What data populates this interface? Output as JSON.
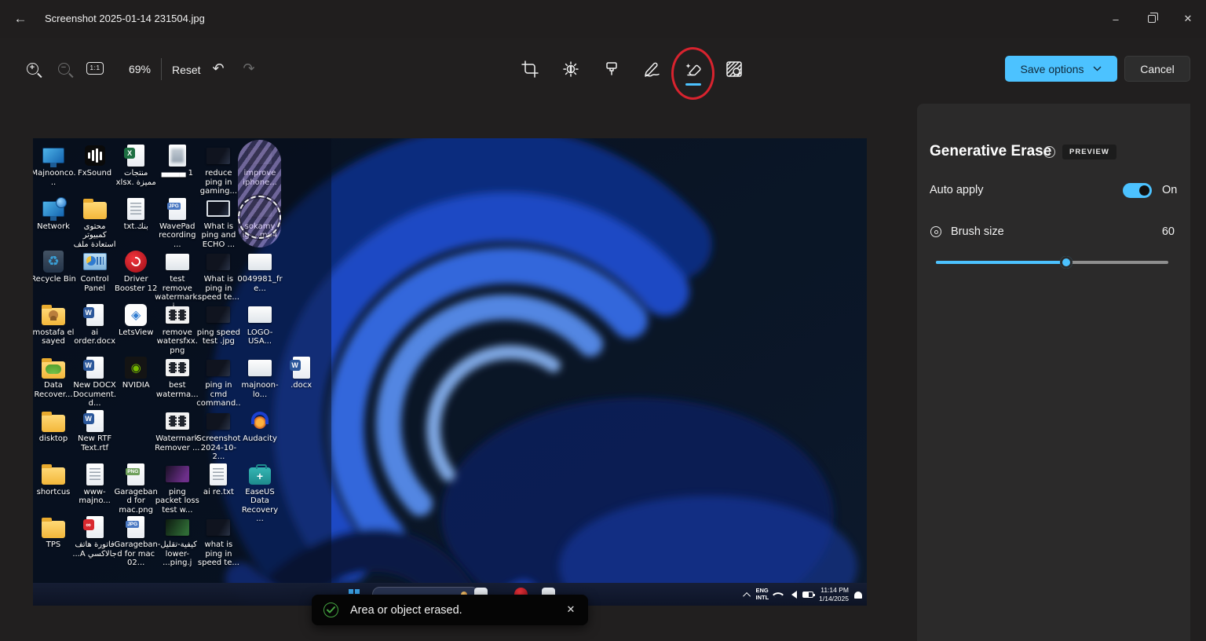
{
  "window": {
    "title": "Screenshot 2025-01-14 231504.jpg"
  },
  "toolbar": {
    "zoom_level": "69%",
    "fit_label": "1:1",
    "reset_label": "Reset",
    "tools": [
      {
        "id": "crop",
        "name": "crop"
      },
      {
        "id": "adjust",
        "name": "adjustment"
      },
      {
        "id": "filter",
        "name": "filter"
      },
      {
        "id": "markup",
        "name": "markup"
      },
      {
        "id": "erase",
        "name": "erase",
        "selected": true
      },
      {
        "id": "background",
        "name": "background"
      }
    ],
    "save_label": "Save options",
    "cancel_label": "Cancel"
  },
  "panel": {
    "title": "Generative Erase",
    "preview_badge": "PREVIEW",
    "auto_apply_label": "Auto apply",
    "auto_apply_state": "On",
    "brush_size_label": "Brush size",
    "brush_size_value": "60",
    "slider_percent": 56
  },
  "toast": {
    "message": "Area or object erased."
  },
  "colors": {
    "accent": "#4cc2ff",
    "annotation_red": "#d8232e",
    "toast_green": "#44a340"
  },
  "photo": {
    "taskbar": {
      "lang_line1": "ENG",
      "lang_line2": "INTL",
      "time": "11:14 PM",
      "date": "1/14/2025"
    },
    "icons": [
      {
        "r": 1,
        "c": 1,
        "label": "Majnoonco...",
        "type": "monitor"
      },
      {
        "r": 1,
        "c": 2,
        "label": "FxSound",
        "type": "fxsound"
      },
      {
        "r": 1,
        "c": 3,
        "label": "منتجات مميزة .xlsx",
        "type": "excel"
      },
      {
        "r": 1,
        "c": 4,
        "label": "▄▄▄▄ 1",
        "type": "doc-blur"
      },
      {
        "r": 1,
        "c": 5,
        "label": "reduce ping in gaming...",
        "type": "thumb-dark"
      },
      {
        "r": 1,
        "c": 6,
        "label": "improve iphone...",
        "type": "thumb-dark"
      },
      {
        "r": 2,
        "c": 1,
        "label": "Network",
        "type": "monitor-globe"
      },
      {
        "r": 2,
        "c": 2,
        "label": "محتوى كمبيوتر استعادة ملف",
        "type": "folder"
      },
      {
        "r": 2,
        "c": 3,
        "label": "بنك.txt",
        "type": "txt"
      },
      {
        "r": 2,
        "c": 4,
        "label": "WavePad recording ...",
        "type": "jpg-doc"
      },
      {
        "r": 2,
        "c": 5,
        "label": "What is ping and ECHO ...",
        "type": "thumb-frame"
      },
      {
        "r": 2,
        "c": 6,
        "label": "sokamy ig-...mp4",
        "type": "thumb-dark"
      },
      {
        "r": 3,
        "c": 1,
        "label": "Recycle Bin",
        "type": "recycle"
      },
      {
        "r": 3,
        "c": 2,
        "label": "Control Panel",
        "type": "control-panel"
      },
      {
        "r": 3,
        "c": 3,
        "label": "Driver Booster 12",
        "type": "driver"
      },
      {
        "r": 3,
        "c": 4,
        "label": "test remove watermark.j...",
        "type": "thumb-light"
      },
      {
        "r": 3,
        "c": 5,
        "label": "What is ping in speed te...",
        "type": "thumb-dark"
      },
      {
        "r": 3,
        "c": 6,
        "label": "0049981_fre...",
        "type": "thumb-light"
      },
      {
        "r": 4,
        "c": 1,
        "label": "mostafa el sayed",
        "type": "folder-user"
      },
      {
        "r": 4,
        "c": 2,
        "label": "ai order.docx",
        "type": "word"
      },
      {
        "r": 4,
        "c": 3,
        "label": "LetsView",
        "type": "letsview"
      },
      {
        "r": 4,
        "c": 4,
        "label": "remove watersfxx.png",
        "type": "film"
      },
      {
        "r": 4,
        "c": 5,
        "label": "ping speed test .jpg",
        "type": "thumb-dark"
      },
      {
        "r": 4,
        "c": 6,
        "label": "LOGO-USA...",
        "type": "thumb-light"
      },
      {
        "r": 5,
        "c": 1,
        "label": "Data Recover...",
        "type": "folder-img"
      },
      {
        "r": 5,
        "c": 2,
        "label": "New DOCX Document.d...",
        "type": "word"
      },
      {
        "r": 5,
        "c": 3,
        "label": "NVIDIA",
        "type": "nvidia"
      },
      {
        "r": 5,
        "c": 4,
        "label": "best waterma...",
        "type": "film"
      },
      {
        "r": 5,
        "c": 5,
        "label": "ping in cmd command...",
        "type": "thumb-dark"
      },
      {
        "r": 5,
        "c": 6,
        "label": "majnoon-lo...",
        "type": "thumb-light"
      },
      {
        "r": 5,
        "c": 7,
        "label": ".docx",
        "type": "word"
      },
      {
        "r": 6,
        "c": 1,
        "label": "disktop",
        "type": "folder"
      },
      {
        "r": 6,
        "c": 2,
        "label": "New RTF Text.rtf",
        "type": "word"
      },
      {
        "r": 6,
        "c": 4,
        "label": "Watermark Remover ...",
        "type": "film"
      },
      {
        "r": 6,
        "c": 5,
        "label": "Screenshot 2024-10-2...",
        "type": "thumb-dark"
      },
      {
        "r": 6,
        "c": 6,
        "label": "Audacity",
        "type": "audacity"
      },
      {
        "r": 7,
        "c": 1,
        "label": "shortcus",
        "type": "folder"
      },
      {
        "r": 7,
        "c": 2,
        "label": "www-majno...",
        "type": "txt"
      },
      {
        "r": 7,
        "c": 3,
        "label": "Garageband for mac.png",
        "type": "png-doc"
      },
      {
        "r": 7,
        "c": 4,
        "label": "ping packet loss test w...",
        "type": "thumb-purple"
      },
      {
        "r": 7,
        "c": 5,
        "label": "ai re.txt",
        "type": "txt"
      },
      {
        "r": 7,
        "c": 6,
        "label": "EaseUS Data Recovery ...",
        "type": "easeus"
      },
      {
        "r": 8,
        "c": 1,
        "label": "TPS",
        "type": "folder"
      },
      {
        "r": 8,
        "c": 2,
        "label": "فاتورة هاتف جالاكسي A...",
        "type": "pdf"
      },
      {
        "r": 8,
        "c": 3,
        "label": "Garageband for mac 02...",
        "type": "jpg-doc"
      },
      {
        "r": 8,
        "c": 4,
        "label": "كيفية-تقليل-lower-ping.j...",
        "type": "thumb-green"
      },
      {
        "r": 8,
        "c": 5,
        "label": "what is ping in speed te...",
        "type": "thumb-dark"
      }
    ]
  }
}
